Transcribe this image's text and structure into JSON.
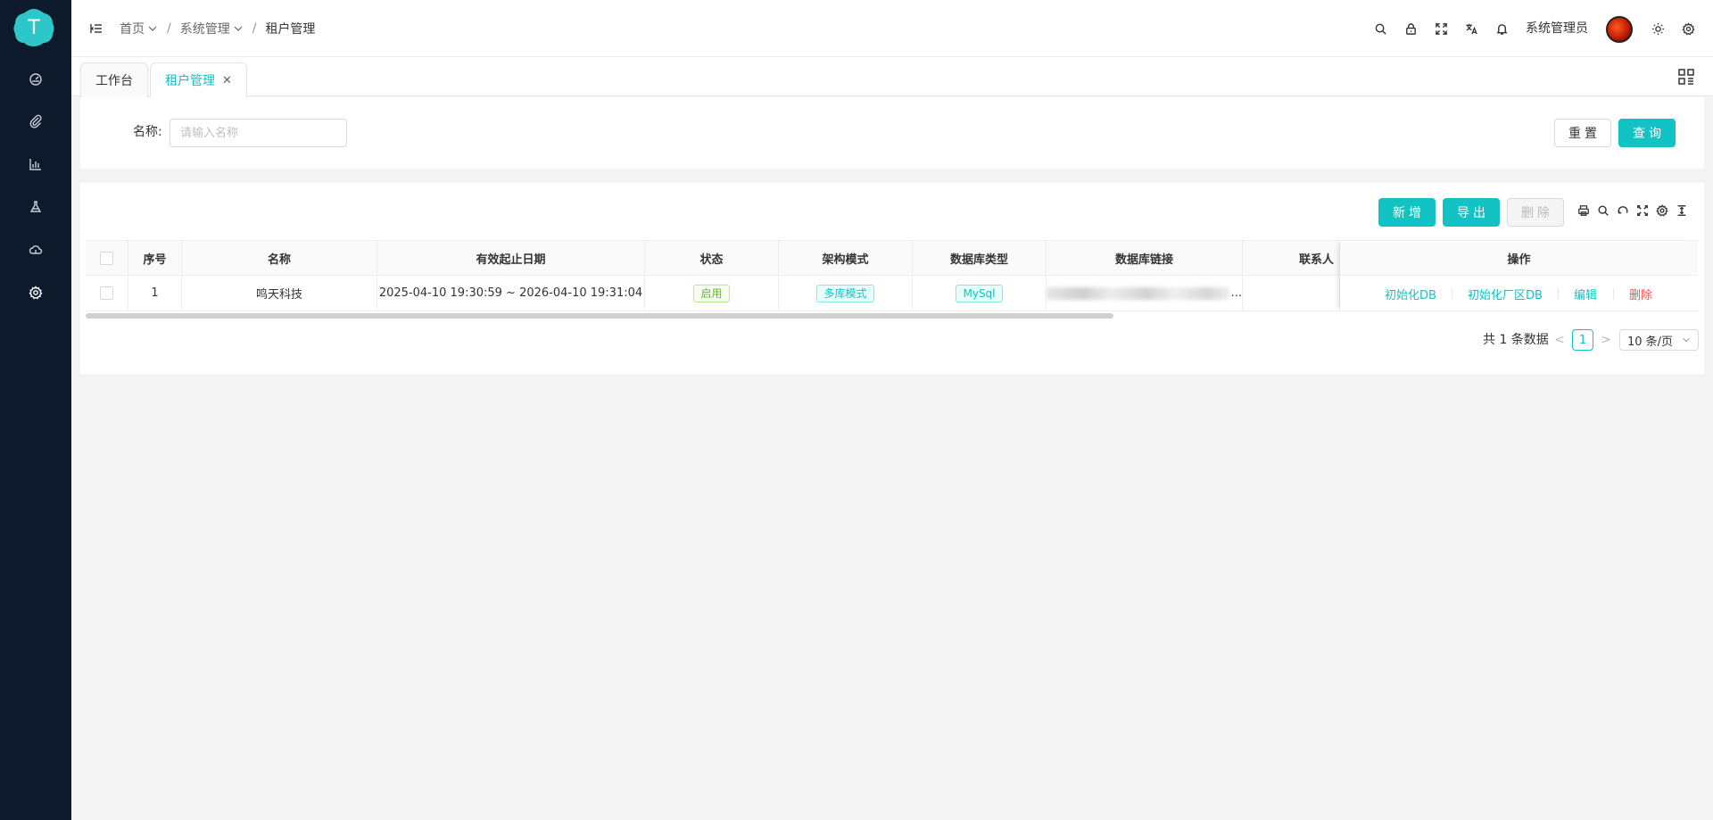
{
  "colors": {
    "accent": "#13c2c2",
    "sidebar_bg": "#0d1a2b",
    "danger": "#ff4d4f",
    "success": "#52c41a"
  },
  "sidebar": {
    "logo_letter": "T",
    "items": [
      {
        "icon": "dashboard-icon"
      },
      {
        "icon": "paperclip-icon"
      },
      {
        "icon": "bar-chart-icon"
      },
      {
        "icon": "flask-icon"
      },
      {
        "icon": "cloud-icon"
      },
      {
        "icon": "gear-icon",
        "active": true
      }
    ]
  },
  "header": {
    "breadcrumb": [
      {
        "label": "首页",
        "has_dropdown": true
      },
      {
        "label": "系统管理",
        "has_dropdown": true
      },
      {
        "label": "租户管理",
        "has_dropdown": false
      }
    ],
    "separator": "/",
    "icons": [
      "search-icon",
      "lock-icon",
      "fullscreen-icon",
      "translate-icon",
      "bell-icon"
    ],
    "user_name": "系统管理员",
    "extra_icons": [
      "sun-icon",
      "gear-icon"
    ]
  },
  "tabs": [
    {
      "label": "工作台",
      "active": false
    },
    {
      "label": "租户管理",
      "active": true,
      "close": "✕"
    }
  ],
  "search": {
    "name_label": "名称:",
    "name_placeholder": "请输入名称",
    "name_value": "",
    "reset_label": "重置",
    "query_label": "查询"
  },
  "toolbar": {
    "add_label": "新增",
    "export_label": "导出",
    "delete_label": "删除",
    "icons": [
      "print-icon",
      "search-icon",
      "refresh-icon",
      "fullscreen-icon",
      "settings-icon",
      "column-height-icon"
    ]
  },
  "table": {
    "columns": [
      "序号",
      "名称",
      "有效起止日期",
      "状态",
      "架构模式",
      "数据库类型",
      "数据库链接",
      "联系人",
      "操作"
    ],
    "rows": [
      {
        "index": "1",
        "name": "鸣天科技",
        "date_range": "2025-04-10 19:30:59 ~ 2026-04-10 19:31:04",
        "status": "启用",
        "mode": "多库模式",
        "db_type": "MySql",
        "db_link_suffix": "...",
        "contact": "",
        "actions": [
          "初始化DB",
          "初始化厂区DB",
          "编辑",
          "删除"
        ]
      }
    ]
  },
  "pagination": {
    "total_text": "共 1 条数据",
    "prev": "<",
    "next": ">",
    "current_page": "1",
    "page_size": "10 条/页"
  }
}
